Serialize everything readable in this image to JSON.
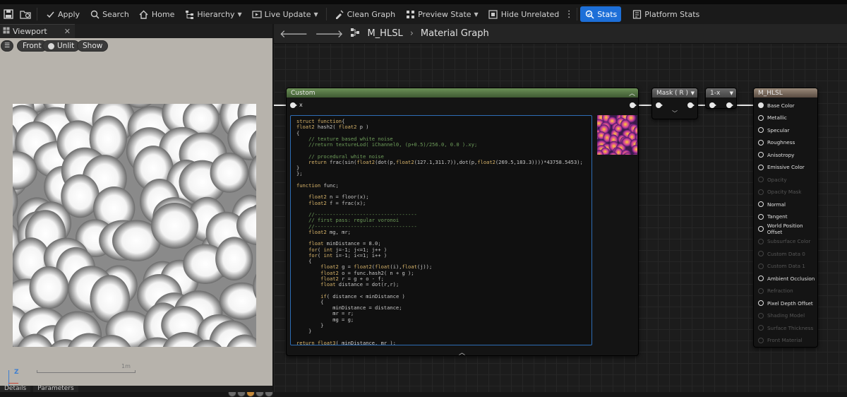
{
  "toolbar": {
    "items": [
      {
        "label": "Apply",
        "icon": "apply-icon"
      },
      {
        "label": "Search",
        "icon": "search-icon"
      },
      {
        "label": "Home",
        "icon": "home-icon"
      },
      {
        "label": "Hierarchy",
        "icon": "hierarchy-icon"
      },
      {
        "label": "Live Update",
        "icon": "live-update-icon"
      },
      {
        "label": "Clean Graph",
        "icon": "clean-graph-icon"
      },
      {
        "label": "Preview State",
        "icon": "preview-state-icon"
      },
      {
        "label": "Hide Unrelated",
        "icon": "hide-unrelated-icon"
      },
      {
        "label": "Stats",
        "icon": "stats-icon"
      },
      {
        "label": "Platform Stats",
        "icon": "platform-stats-icon"
      }
    ]
  },
  "viewport": {
    "tab_label": "Viewport",
    "view_mode": "Front",
    "lighting": "Unlit",
    "show": "Show",
    "scale_label": "1m",
    "axis_label": "Z"
  },
  "bottom_tabs": [
    "Details",
    "Parameters"
  ],
  "graph": {
    "asset_name": "M_HLSL",
    "breadcrumb": "Material Graph"
  },
  "nodes": {
    "custom": {
      "title": "Custom",
      "input": "x"
    },
    "mask": {
      "title": "Mask ( R )"
    },
    "one_minus": {
      "title": "1-x"
    },
    "material": {
      "title": "M_HLSL",
      "pins": [
        {
          "label": "Base Color",
          "enabled": true
        },
        {
          "label": "Metallic",
          "enabled": true
        },
        {
          "label": "Specular",
          "enabled": true
        },
        {
          "label": "Roughness",
          "enabled": true
        },
        {
          "label": "Anisotropy",
          "enabled": true
        },
        {
          "label": "Emissive Color",
          "enabled": true
        },
        {
          "label": "Opacity",
          "enabled": false
        },
        {
          "label": "Opacity Mask",
          "enabled": false
        },
        {
          "label": "Normal",
          "enabled": true
        },
        {
          "label": "Tangent",
          "enabled": true
        },
        {
          "label": "World Position Offset",
          "enabled": true
        },
        {
          "label": "Subsurface Color",
          "enabled": false
        },
        {
          "label": "Custom Data 0",
          "enabled": false
        },
        {
          "label": "Custom Data 1",
          "enabled": false
        },
        {
          "label": "Ambient Occlusion",
          "enabled": true
        },
        {
          "label": "Refraction",
          "enabled": false
        },
        {
          "label": "Pixel Depth Offset",
          "enabled": true
        },
        {
          "label": "Shading Model",
          "enabled": false
        },
        {
          "label": "Surface Thickness",
          "enabled": false
        },
        {
          "label": "Front Material",
          "enabled": false
        }
      ]
    }
  },
  "code_lines": [
    "struct function{",
    "float2 hash2( float2 p )",
    "{",
    "    // texture based white noise",
    "    //return textureLod( iChannel0, (p+0.5)/256.0, 0.0 ).xy;",
    "",
    "    // procedural white noise",
    "    return frac(sin(float2(dot(p,float2(127.1,311.7)),dot(p,float2(269.5,183.3))))*43758.5453);",
    "}",
    "};",
    "",
    "function func;",
    "",
    "    float2 n = floor(x);",
    "    float2 f = frac(x);",
    "",
    "    //----------------------------------",
    "    // first pass: regular voronoi",
    "    //----------------------------------",
    "    float2 mg, mr;",
    "",
    "    float minDistance = 8.0;",
    "    for( int j=-1; j<=1; j++ )",
    "    for( int i=-1; i<=1; i++ )",
    "    {",
    "        float2 g = float2(float(i),float(j));",
    "        float2 o = func.hash2( n + g );",
    "        float2 r = g + o - f;",
    "        float distance = dot(r,r);",
    "",
    "        if( distance < minDistance )",
    "        {",
    "            minDistance = distance;",
    "            mr = r;",
    "            mg = g;",
    "        }",
    "    }",
    "",
    "return float3( minDistance, mr );"
  ]
}
